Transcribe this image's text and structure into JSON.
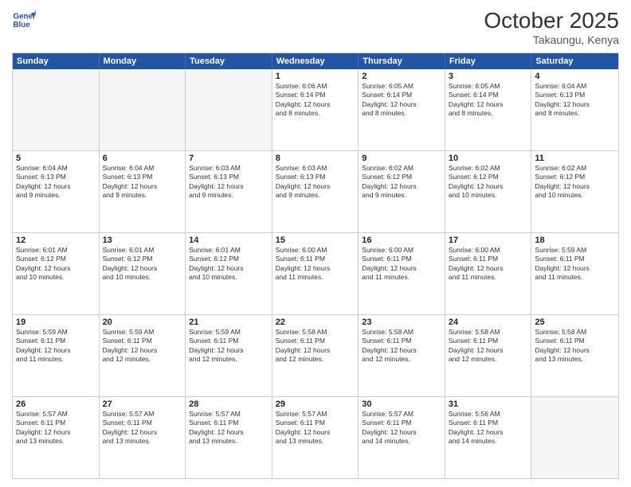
{
  "header": {
    "logo_line1": "General",
    "logo_line2": "Blue",
    "month": "October 2025",
    "location": "Takaungu, Kenya"
  },
  "weekdays": [
    "Sunday",
    "Monday",
    "Tuesday",
    "Wednesday",
    "Thursday",
    "Friday",
    "Saturday"
  ],
  "rows": [
    [
      {
        "day": "",
        "empty": true
      },
      {
        "day": "",
        "empty": true
      },
      {
        "day": "",
        "empty": true
      },
      {
        "day": "1",
        "info": "Sunrise: 6:06 AM\nSunset: 6:14 PM\nDaylight: 12 hours\nand 8 minutes."
      },
      {
        "day": "2",
        "info": "Sunrise: 6:05 AM\nSunset: 6:14 PM\nDaylight: 12 hours\nand 8 minutes."
      },
      {
        "day": "3",
        "info": "Sunrise: 6:05 AM\nSunset: 6:14 PM\nDaylight: 12 hours\nand 8 minutes."
      },
      {
        "day": "4",
        "info": "Sunrise: 6:04 AM\nSunset: 6:13 PM\nDaylight: 12 hours\nand 8 minutes."
      }
    ],
    [
      {
        "day": "5",
        "info": "Sunrise: 6:04 AM\nSunset: 6:13 PM\nDaylight: 12 hours\nand 9 minutes."
      },
      {
        "day": "6",
        "info": "Sunrise: 6:04 AM\nSunset: 6:13 PM\nDaylight: 12 hours\nand 9 minutes."
      },
      {
        "day": "7",
        "info": "Sunrise: 6:03 AM\nSunset: 6:13 PM\nDaylight: 12 hours\nand 9 minutes."
      },
      {
        "day": "8",
        "info": "Sunrise: 6:03 AM\nSunset: 6:13 PM\nDaylight: 12 hours\nand 9 minutes."
      },
      {
        "day": "9",
        "info": "Sunrise: 6:02 AM\nSunset: 6:12 PM\nDaylight: 12 hours\nand 9 minutes."
      },
      {
        "day": "10",
        "info": "Sunrise: 6:02 AM\nSunset: 6:12 PM\nDaylight: 12 hours\nand 10 minutes."
      },
      {
        "day": "11",
        "info": "Sunrise: 6:02 AM\nSunset: 6:12 PM\nDaylight: 12 hours\nand 10 minutes."
      }
    ],
    [
      {
        "day": "12",
        "info": "Sunrise: 6:01 AM\nSunset: 6:12 PM\nDaylight: 12 hours\nand 10 minutes."
      },
      {
        "day": "13",
        "info": "Sunrise: 6:01 AM\nSunset: 6:12 PM\nDaylight: 12 hours\nand 10 minutes."
      },
      {
        "day": "14",
        "info": "Sunrise: 6:01 AM\nSunset: 6:12 PM\nDaylight: 12 hours\nand 10 minutes."
      },
      {
        "day": "15",
        "info": "Sunrise: 6:00 AM\nSunset: 6:11 PM\nDaylight: 12 hours\nand 11 minutes."
      },
      {
        "day": "16",
        "info": "Sunrise: 6:00 AM\nSunset: 6:11 PM\nDaylight: 12 hours\nand 11 minutes."
      },
      {
        "day": "17",
        "info": "Sunrise: 6:00 AM\nSunset: 6:11 PM\nDaylight: 12 hours\nand 11 minutes."
      },
      {
        "day": "18",
        "info": "Sunrise: 5:59 AM\nSunset: 6:11 PM\nDaylight: 12 hours\nand 11 minutes."
      }
    ],
    [
      {
        "day": "19",
        "info": "Sunrise: 5:59 AM\nSunset: 6:11 PM\nDaylight: 12 hours\nand 11 minutes."
      },
      {
        "day": "20",
        "info": "Sunrise: 5:59 AM\nSunset: 6:11 PM\nDaylight: 12 hours\nand 12 minutes."
      },
      {
        "day": "21",
        "info": "Sunrise: 5:59 AM\nSunset: 6:11 PM\nDaylight: 12 hours\nand 12 minutes."
      },
      {
        "day": "22",
        "info": "Sunrise: 5:58 AM\nSunset: 6:11 PM\nDaylight: 12 hours\nand 12 minutes."
      },
      {
        "day": "23",
        "info": "Sunrise: 5:58 AM\nSunset: 6:11 PM\nDaylight: 12 hours\nand 12 minutes."
      },
      {
        "day": "24",
        "info": "Sunrise: 5:58 AM\nSunset: 6:11 PM\nDaylight: 12 hours\nand 12 minutes."
      },
      {
        "day": "25",
        "info": "Sunrise: 5:58 AM\nSunset: 6:11 PM\nDaylight: 12 hours\nand 13 minutes."
      }
    ],
    [
      {
        "day": "26",
        "info": "Sunrise: 5:57 AM\nSunset: 6:11 PM\nDaylight: 12 hours\nand 13 minutes."
      },
      {
        "day": "27",
        "info": "Sunrise: 5:57 AM\nSunset: 6:11 PM\nDaylight: 12 hours\nand 13 minutes."
      },
      {
        "day": "28",
        "info": "Sunrise: 5:57 AM\nSunset: 6:11 PM\nDaylight: 12 hours\nand 13 minutes."
      },
      {
        "day": "29",
        "info": "Sunrise: 5:57 AM\nSunset: 6:11 PM\nDaylight: 12 hours\nand 13 minutes."
      },
      {
        "day": "30",
        "info": "Sunrise: 5:57 AM\nSunset: 6:11 PM\nDaylight: 12 hours\nand 14 minutes."
      },
      {
        "day": "31",
        "info": "Sunrise: 5:56 AM\nSunset: 6:11 PM\nDaylight: 12 hours\nand 14 minutes."
      },
      {
        "day": "",
        "empty": true
      }
    ]
  ]
}
